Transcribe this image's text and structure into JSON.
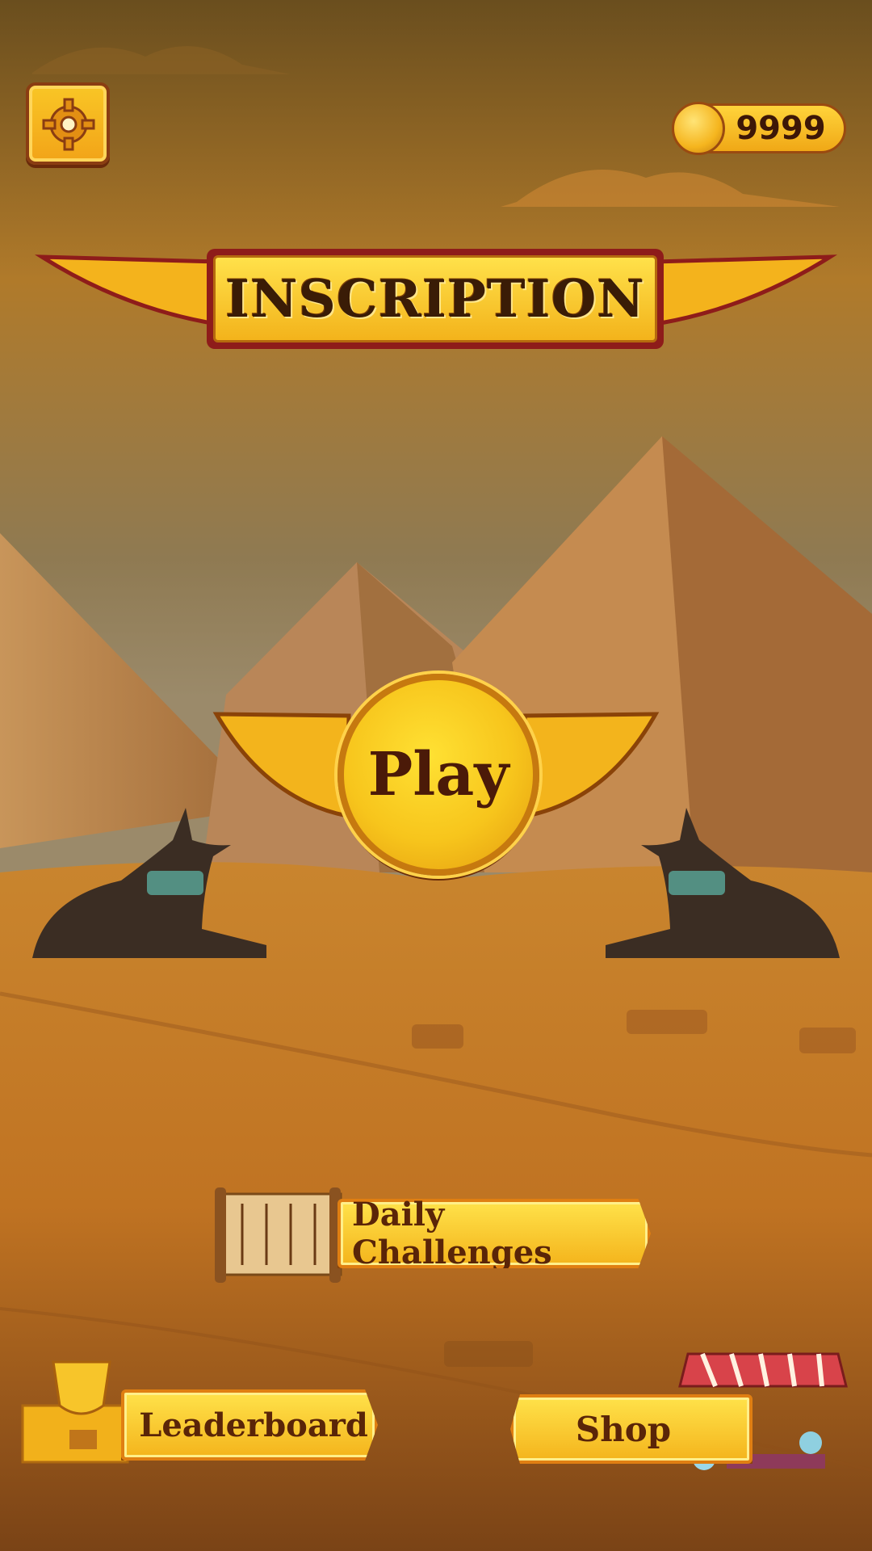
{
  "game": {
    "title": "INSCRIPTION"
  },
  "hud": {
    "settings_icon": "gear-icon",
    "coin_icon": "ankh-coin-icon",
    "coins": "9999"
  },
  "menu": {
    "play_label": "Play",
    "daily_label": "Daily Challenges",
    "leaderboard_label": "Leaderboard",
    "shop_label": "Shop"
  },
  "colors": {
    "gold": "#f7c51c",
    "deep_red": "#8e1c1a",
    "text_brown": "#4b1a08",
    "sand": "#c57d2a"
  }
}
